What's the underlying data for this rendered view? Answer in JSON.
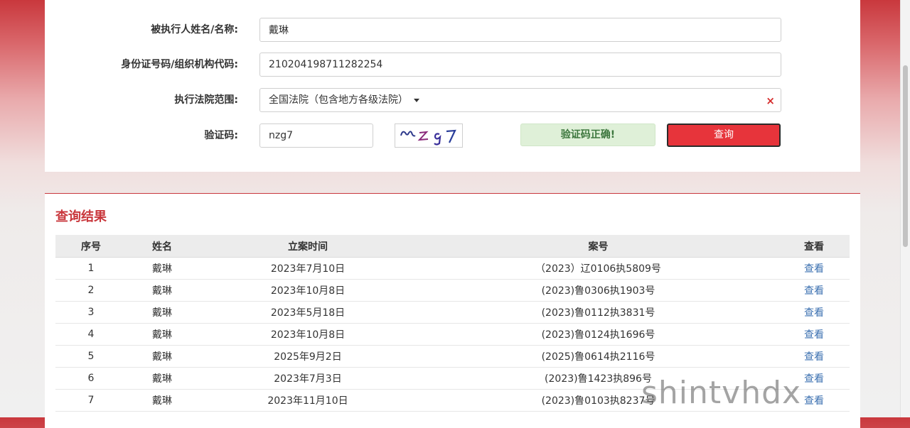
{
  "form": {
    "name_label": "被执行人姓名/名称:",
    "name_value": "戴琳",
    "id_label": "身份证号码/组织机构代码:",
    "id_value": "210204198711282254",
    "court_label": "执行法院范围:",
    "court_value": "全国法院（包含地方各级法院）",
    "clear_icon": "×",
    "captcha_label": "验证码:",
    "captcha_value": "nzg7",
    "captcha_image_text": "nzg7",
    "captcha_status": "验证码正确!",
    "query_button": "查询"
  },
  "results": {
    "title": "查询结果",
    "columns": [
      "序号",
      "姓名",
      "立案时间",
      "案号",
      "查看"
    ],
    "rows": [
      {
        "no": "1",
        "name": "戴琳",
        "date": "2023年7月10日",
        "case": "（2023）辽0106执5809号",
        "view": "查看"
      },
      {
        "no": "2",
        "name": "戴琳",
        "date": "2023年10月8日",
        "case": "(2023)鲁0306执1903号",
        "view": "查看"
      },
      {
        "no": "3",
        "name": "戴琳",
        "date": "2023年5月18日",
        "case": "(2023)鲁0112执3831号",
        "view": "查看"
      },
      {
        "no": "4",
        "name": "戴琳",
        "date": "2023年10月8日",
        "case": "(2023)鲁0124执1696号",
        "view": "查看"
      },
      {
        "no": "5",
        "name": "戴琳",
        "date": "2025年9月2日",
        "case": "(2025)鲁0614执2116号",
        "view": "查看"
      },
      {
        "no": "6",
        "name": "戴琳",
        "date": "2023年7月3日",
        "case": "(2023)鲁1423执896号",
        "view": "查看"
      },
      {
        "no": "7",
        "name": "戴琳",
        "date": "2023年11月10日",
        "case": "(2023)鲁0103执8237号",
        "view": "查看"
      }
    ]
  },
  "watermark": "shintvhdx",
  "colors": {
    "accent": "#c9383d",
    "button": "#e7343b",
    "link": "#3a6fb0",
    "success_bg": "#dff0d8",
    "success_text": "#3c763d"
  }
}
